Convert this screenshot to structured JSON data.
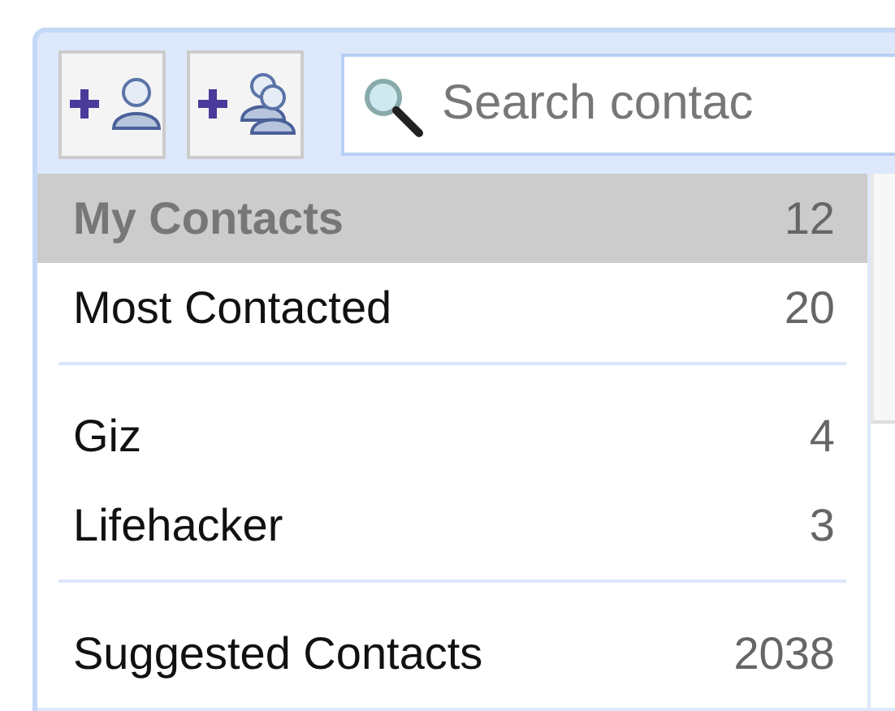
{
  "toolbar": {
    "buttons": [
      {
        "kind": "add-contact"
      },
      {
        "kind": "add-group"
      }
    ],
    "search": {
      "placeholder": "Search contac"
    }
  },
  "sidebar": {
    "sections": [
      {
        "items": [
          {
            "label": "My Contacts",
            "count": "12",
            "selected": true
          },
          {
            "label": "Most Contacted",
            "count": "20",
            "selected": false
          }
        ]
      },
      {
        "items": [
          {
            "label": "Giz",
            "count": "4",
            "selected": false
          },
          {
            "label": "Lifehacker",
            "count": "3",
            "selected": false
          }
        ]
      },
      {
        "items": [
          {
            "label": "Suggested Contacts",
            "count": "2038",
            "selected": false
          }
        ]
      }
    ]
  }
}
